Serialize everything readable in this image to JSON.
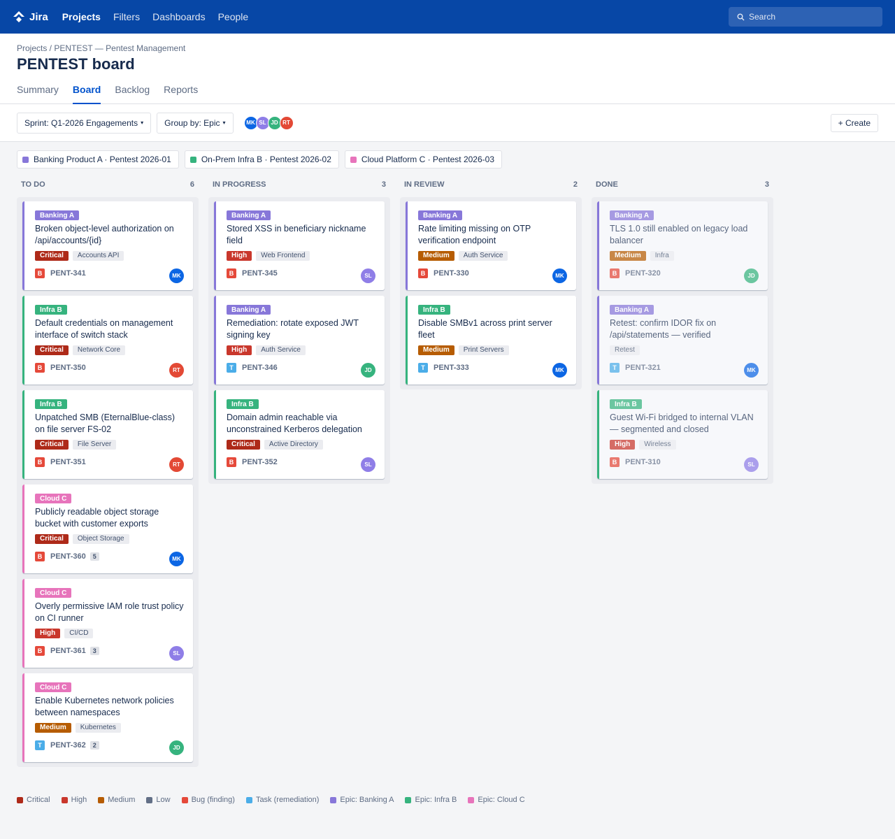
{
  "topbar": {
    "app_name": "Jira",
    "nav": [
      "Projects",
      "Filters",
      "Dashboards",
      "People"
    ],
    "active_nav": "Projects",
    "search_placeholder": "Search"
  },
  "header": {
    "breadcrumb": "Projects / PENTEST — Pentest Management",
    "title": "PENTEST board",
    "tabs": [
      "Summary",
      "Board",
      "Backlog",
      "Reports"
    ],
    "active_tab": "Board"
  },
  "toolbar": {
    "sprint_label": "Sprint: Q1-2026 Engagements",
    "group_label": "Group by: Epic",
    "create_label": "+ Create",
    "avatars": [
      "MK",
      "SL",
      "JD",
      "RT"
    ]
  },
  "people": {
    "MK": "#0c66e4",
    "SL": "#8f7ee7",
    "JD": "#36b37e",
    "RT": "#e34935"
  },
  "epics": {
    "A": {
      "short": "Banking A",
      "full": "Banking Product A · Pentest 2026-01",
      "color": "#8777d9"
    },
    "B": {
      "short": "Infra B",
      "full": "On-Prem Infra B · Pentest 2026-02",
      "color": "#36b37e"
    },
    "C": {
      "short": "Cloud C",
      "full": "Cloud Platform C · Pentest 2026-03",
      "color": "#e774bb"
    }
  },
  "severity_colors": {
    "Critical": "#ae2a19",
    "High": "#c9372c",
    "Medium": "#b65c02",
    "Low": "#626f86"
  },
  "type_colors": {
    "B": "#e5493a",
    "T": "#4bade8"
  },
  "columns": [
    {
      "name": "TO DO",
      "count": "6",
      "cards": [
        {
          "epic": "A",
          "title": "Broken object-level authorization on /api/accounts/{id}",
          "severity": "Critical",
          "component": "Accounts API",
          "type": "B",
          "key": "PENT-341",
          "assignee": "MK",
          "count": ""
        },
        {
          "epic": "B",
          "title": "Default credentials on management interface of switch stack",
          "severity": "Critical",
          "component": "Network Core",
          "type": "B",
          "key": "PENT-350",
          "assignee": "RT",
          "count": ""
        },
        {
          "epic": "B",
          "title": "Unpatched SMB (EternalBlue-class) on file server FS-02",
          "severity": "Critical",
          "component": "File Server",
          "type": "B",
          "key": "PENT-351",
          "assignee": "RT",
          "count": ""
        },
        {
          "epic": "C",
          "title": "Publicly readable object storage bucket with customer exports",
          "severity": "Critical",
          "component": "Object Storage",
          "type": "B",
          "key": "PENT-360",
          "assignee": "MK",
          "count": "5"
        },
        {
          "epic": "C",
          "title": "Overly permissive IAM role trust policy on CI runner",
          "severity": "High",
          "component": "CI/CD",
          "type": "B",
          "key": "PENT-361",
          "assignee": "SL",
          "count": "3"
        },
        {
          "epic": "C",
          "title": "Enable Kubernetes network policies between namespaces",
          "severity": "Medium",
          "component": "Kubernetes",
          "type": "T",
          "key": "PENT-362",
          "assignee": "JD",
          "count": "2"
        }
      ]
    },
    {
      "name": "IN PROGRESS",
      "count": "3",
      "cards": [
        {
          "epic": "A",
          "title": "Stored XSS in beneficiary nickname field",
          "severity": "High",
          "component": "Web Frontend",
          "type": "B",
          "key": "PENT-345",
          "assignee": "SL",
          "count": ""
        },
        {
          "epic": "A",
          "title": "Remediation: rotate exposed JWT signing key",
          "severity": "High",
          "component": "Auth Service",
          "type": "T",
          "key": "PENT-346",
          "assignee": "JD",
          "count": ""
        },
        {
          "epic": "B",
          "title": "Domain admin reachable via unconstrained Kerberos delegation",
          "severity": "Critical",
          "component": "Active Directory",
          "type": "B",
          "key": "PENT-352",
          "assignee": "SL",
          "count": ""
        }
      ]
    },
    {
      "name": "IN REVIEW",
      "count": "2",
      "cards": [
        {
          "epic": "A",
          "title": "Rate limiting missing on OTP verification endpoint",
          "severity": "Medium",
          "component": "Auth Service",
          "type": "B",
          "key": "PENT-330",
          "assignee": "MK",
          "count": ""
        },
        {
          "epic": "B",
          "title": "Disable SMBv1 across print server fleet",
          "severity": "Medium",
          "component": "Print Servers",
          "type": "T",
          "key": "PENT-333",
          "assignee": "MK",
          "count": ""
        }
      ]
    },
    {
      "name": "DONE",
      "count": "3",
      "cards": [
        {
          "epic": "A",
          "title": "TLS 1.0 still enabled on legacy load balancer",
          "severity": "Medium",
          "component": "Infra",
          "type": "B",
          "key": "PENT-320",
          "assignee": "JD",
          "count": ""
        },
        {
          "epic": "A",
          "title": "Retest: confirm IDOR fix on /api/statements — verified",
          "severity": "",
          "component": "Retest",
          "type": "T",
          "key": "PENT-321",
          "assignee": "MK",
          "count": ""
        },
        {
          "epic": "B",
          "title": "Guest Wi-Fi bridged to internal VLAN — segmented and closed",
          "severity": "High",
          "component": "Wireless",
          "type": "B",
          "key": "PENT-310",
          "assignee": "SL",
          "count": ""
        }
      ]
    }
  ],
  "legend": [
    {
      "label": "Critical",
      "color": "#ae2a19"
    },
    {
      "label": "High",
      "color": "#c9372c"
    },
    {
      "label": "Medium",
      "color": "#b65c02"
    },
    {
      "label": "Low",
      "color": "#626f86"
    },
    {
      "label": "Bug (finding)",
      "color": "#e5493a"
    },
    {
      "label": "Task (remediation)",
      "color": "#4bade8"
    },
    {
      "label": "Epic: Banking A",
      "color": "#8777d9"
    },
    {
      "label": "Epic: Infra B",
      "color": "#36b37e"
    },
    {
      "label": "Epic: Cloud C",
      "color": "#e774bb"
    }
  ]
}
